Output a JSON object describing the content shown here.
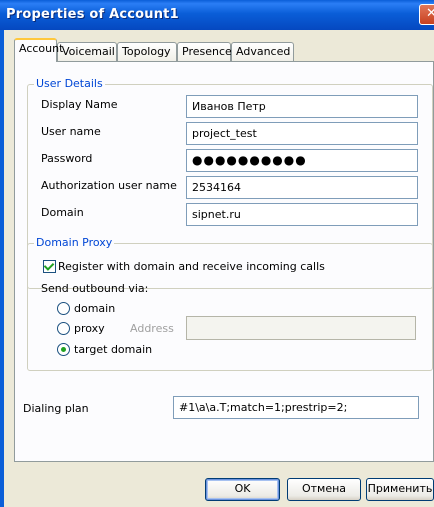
{
  "window": {
    "title": "Properties of Account1"
  },
  "tabs": [
    {
      "label": "Account",
      "active": true
    },
    {
      "label": "Voicemail",
      "active": false
    },
    {
      "label": "Topology",
      "active": false
    },
    {
      "label": "Presence",
      "active": false
    },
    {
      "label": "Advanced",
      "active": false
    }
  ],
  "user_details": {
    "legend": "User Details",
    "display_name": {
      "label": "Display Name",
      "value": "Иванов Петр"
    },
    "user_name": {
      "label": "User name",
      "value": "project_test"
    },
    "password": {
      "label": "Password",
      "value": "●●●●●●●●●●"
    },
    "auth_user_name": {
      "label": "Authorization user name",
      "value": "2534164"
    },
    "domain": {
      "label": "Domain",
      "value": "sipnet.ru"
    }
  },
  "domain_proxy": {
    "legend": "Domain Proxy",
    "register_label": "Register with domain and receive incoming calls",
    "register_checked": true,
    "send_outbound_label": "Send outbound via:",
    "options": [
      {
        "label": "domain",
        "selected": false
      },
      {
        "label": "proxy",
        "selected": false
      },
      {
        "label": "target domain",
        "selected": true
      }
    ],
    "address_label": "Address",
    "address_value": ""
  },
  "dialing_plan": {
    "label": "Dialing plan",
    "value": "#1\\a\\a.T;match=1;prestrip=2;"
  },
  "buttons": {
    "ok": "OK",
    "cancel": "Отмена",
    "apply": "Применить"
  },
  "colors": {
    "title_bar": "#0a5ed8",
    "legend": "#0046d5",
    "dialog_bg": "#ece9d8",
    "check": "#21a121"
  },
  "icons": {
    "close": "close-icon"
  }
}
